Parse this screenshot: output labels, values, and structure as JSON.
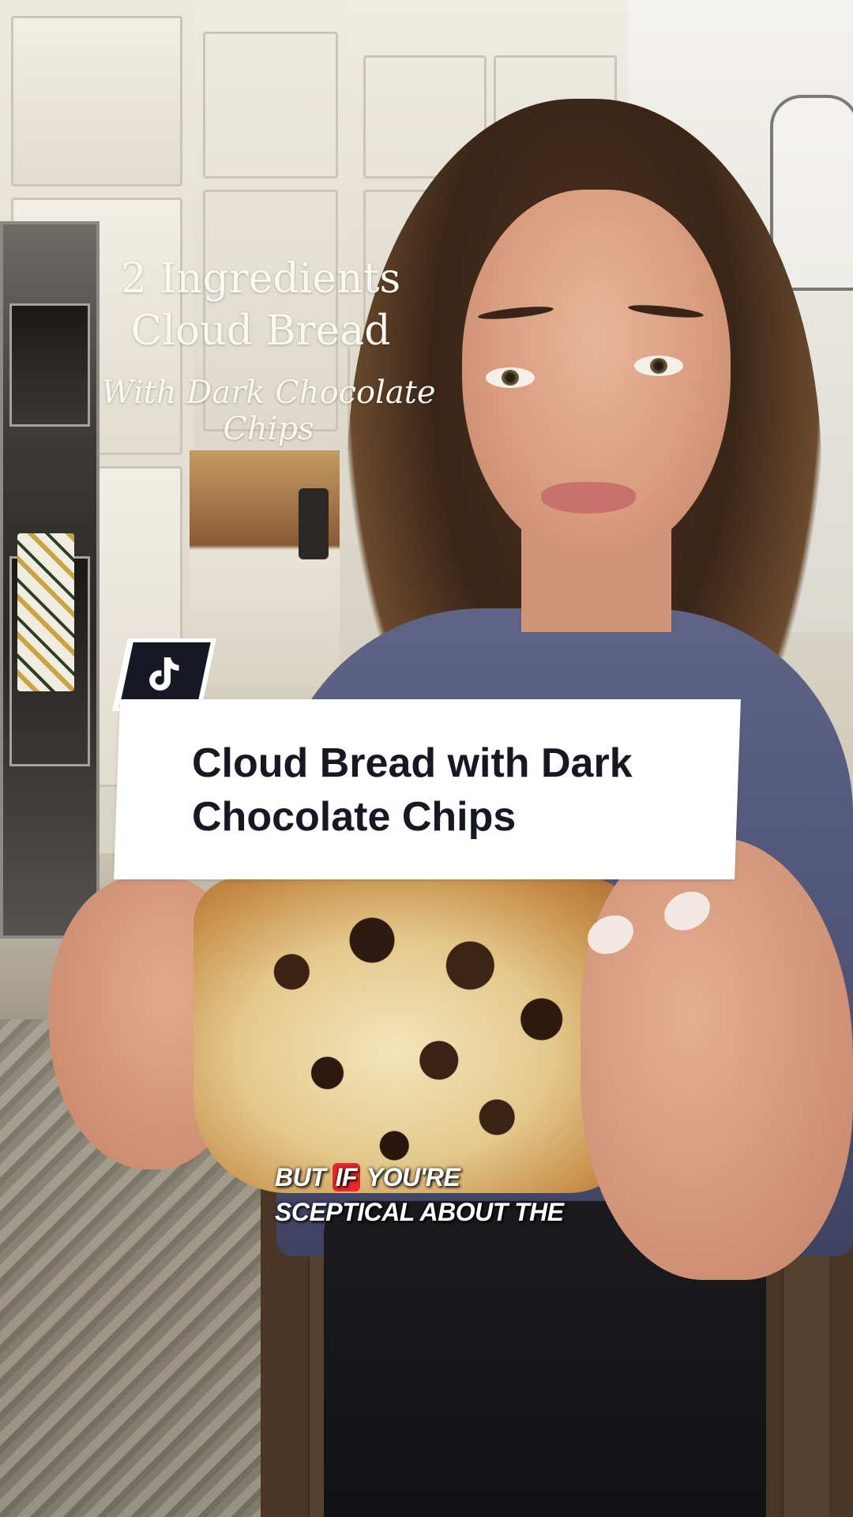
{
  "video": {
    "overlay_title_line1": "2 Ingredients",
    "overlay_title_line2": "Cloud Bread",
    "overlay_subtitle": "With Dark Chocolate Chips"
  },
  "card": {
    "icon": "tiktok-icon",
    "title_line1": "Cloud Bread with Dark",
    "title_line2": "Chocolate Chips",
    "badge_color": "#161823"
  },
  "captions": {
    "line1_word1": "BUT",
    "line1_highlight": "IF",
    "line1_rest": "YOU'RE",
    "line2": "SCEPTICAL ABOUT THE",
    "highlight_color": "#e8282b"
  }
}
